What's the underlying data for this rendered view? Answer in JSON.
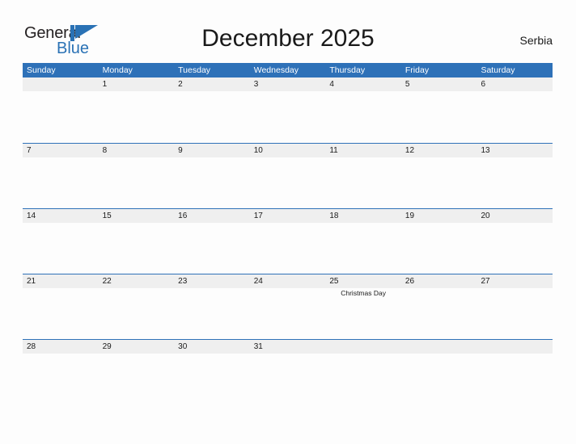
{
  "brand": {
    "name_part1": "General",
    "name_part2": "Blue",
    "flag_icon": "blue-triangle-flag",
    "colors": {
      "dark": "#231f20",
      "blue": "#2a72b5"
    }
  },
  "header": {
    "title": "December 2025",
    "region": "Serbia"
  },
  "theme": {
    "header_blue": "#2e71b8",
    "band_gray": "#efefef",
    "page_background": "#fdfdfd",
    "text_dark": "#1a1a1a"
  },
  "calendar": {
    "weekdays": [
      "Sunday",
      "Monday",
      "Tuesday",
      "Wednesday",
      "Thursday",
      "Friday",
      "Saturday"
    ],
    "weeks": [
      [
        {
          "day": "",
          "events": []
        },
        {
          "day": "1",
          "events": []
        },
        {
          "day": "2",
          "events": []
        },
        {
          "day": "3",
          "events": []
        },
        {
          "day": "4",
          "events": []
        },
        {
          "day": "5",
          "events": []
        },
        {
          "day": "6",
          "events": []
        }
      ],
      [
        {
          "day": "7",
          "events": []
        },
        {
          "day": "8",
          "events": []
        },
        {
          "day": "9",
          "events": []
        },
        {
          "day": "10",
          "events": []
        },
        {
          "day": "11",
          "events": []
        },
        {
          "day": "12",
          "events": []
        },
        {
          "day": "13",
          "events": []
        }
      ],
      [
        {
          "day": "14",
          "events": []
        },
        {
          "day": "15",
          "events": []
        },
        {
          "day": "16",
          "events": []
        },
        {
          "day": "17",
          "events": []
        },
        {
          "day": "18",
          "events": []
        },
        {
          "day": "19",
          "events": []
        },
        {
          "day": "20",
          "events": []
        }
      ],
      [
        {
          "day": "21",
          "events": []
        },
        {
          "day": "22",
          "events": []
        },
        {
          "day": "23",
          "events": []
        },
        {
          "day": "24",
          "events": []
        },
        {
          "day": "25",
          "events": [
            "Christmas Day"
          ]
        },
        {
          "day": "26",
          "events": []
        },
        {
          "day": "27",
          "events": []
        }
      ],
      [
        {
          "day": "28",
          "events": []
        },
        {
          "day": "29",
          "events": []
        },
        {
          "day": "30",
          "events": []
        },
        {
          "day": "31",
          "events": []
        },
        {
          "day": "",
          "events": []
        },
        {
          "day": "",
          "events": []
        },
        {
          "day": "",
          "events": []
        }
      ]
    ]
  }
}
